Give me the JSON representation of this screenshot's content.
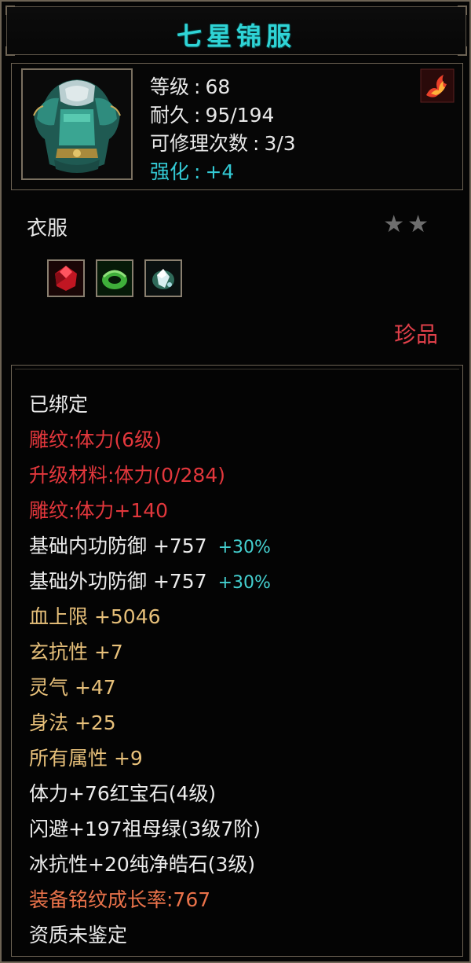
{
  "item": {
    "name": "七星锦服",
    "type": "衣服",
    "rarity": "珍品",
    "stars_filled": 2,
    "stars_total": 2
  },
  "stats": {
    "level_label": "等级",
    "level_value": "68",
    "durability_label": "耐久",
    "durability_value": "95/194",
    "repair_label": "可修理次数",
    "repair_value": "3/3",
    "enhance_label": "强化",
    "enhance_value": "+4"
  },
  "icons": {
    "item_portrait": "armor-portrait-icon",
    "corner_emblem": "flame-emblem-icon",
    "gems": [
      "red-gem-icon",
      "green-jade-ring-icon",
      "white-crystal-icon"
    ],
    "star": "star-icon"
  },
  "details": [
    {
      "text": "已绑定",
      "color": "white"
    },
    {
      "text": "雕纹:体力(6级)",
      "color": "red"
    },
    {
      "text": "升级材料:体力(0/284)",
      "color": "red"
    },
    {
      "text": "雕纹:体力+140",
      "color": "red"
    },
    {
      "text": "基础内功防御  +757",
      "color": "white",
      "extra": "+30%"
    },
    {
      "text": "基础外功防御  +757",
      "color": "white",
      "extra": "+30%"
    },
    {
      "text": "血上限  +5046",
      "color": "gold"
    },
    {
      "text": "玄抗性  +7",
      "color": "gold"
    },
    {
      "text": "灵气  +47",
      "color": "gold"
    },
    {
      "text": "身法  +25",
      "color": "gold"
    },
    {
      "text": "所有属性  +9",
      "color": "gold"
    },
    {
      "text": "体力+76红宝石(4级)",
      "color": "white"
    },
    {
      "text": "闪避+197祖母绿(3级7阶)",
      "color": "white"
    },
    {
      "text": "冰抗性+20纯净皓石(3级)",
      "color": "white"
    },
    {
      "text": "装备铭纹成长率:767",
      "color": "orange"
    },
    {
      "text": "资质未鉴定",
      "color": "white"
    }
  ],
  "colors": {
    "title": "#2fd4d6",
    "border": "#6d6354",
    "red_text": "#e2373c",
    "gold_text": "#e7c07a",
    "orange_text": "#e9724a",
    "cyan_text": "#44d0d0"
  }
}
